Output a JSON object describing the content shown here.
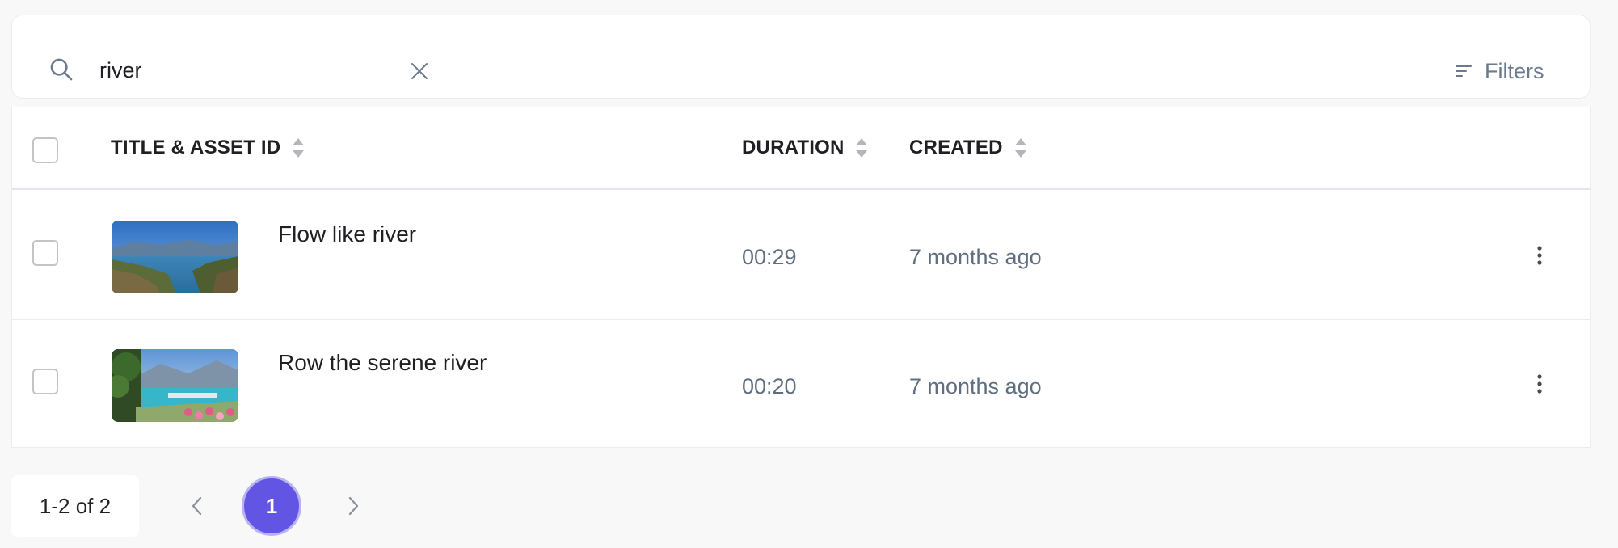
{
  "search": {
    "value": "river",
    "placeholder": "Search"
  },
  "filters": {
    "label": "Filters"
  },
  "table": {
    "columns": {
      "title": "TITLE & ASSET ID",
      "duration": "DURATION",
      "created": "CREATED"
    },
    "rows": [
      {
        "title": "Flow like river",
        "duration": "00:29",
        "created": "7 months ago",
        "thumbnail": "lake-valley-landscape"
      },
      {
        "title": "Row the serene river",
        "duration": "00:20",
        "created": "7 months ago",
        "thumbnail": "lakeside-harbor-flowers"
      }
    ]
  },
  "pagination": {
    "range": "1-2 of 2",
    "current_page": "1"
  },
  "icons": {
    "search": "search-icon",
    "clear": "close-icon",
    "filters": "filter-lines-icon",
    "sort": "sort-icon",
    "menu": "more-vertical-icon",
    "prev": "chevron-left-icon",
    "next": "chevron-right-icon"
  },
  "colors": {
    "accent": "#6355e3",
    "muted_text": "#5f6e80",
    "border": "#ececf0"
  }
}
